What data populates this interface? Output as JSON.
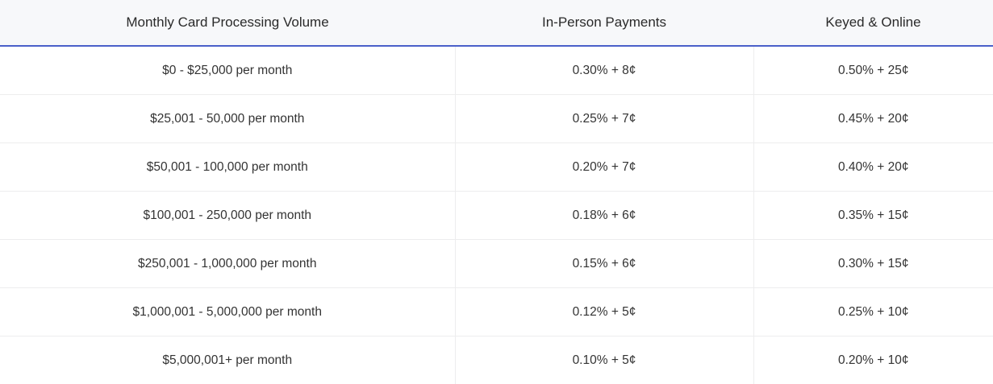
{
  "table": {
    "headers": [
      "Monthly Card Processing Volume",
      "In-Person Payments",
      "Keyed & Online"
    ],
    "rows": [
      [
        "$0 - $25,000 per month",
        "0.30% + 8¢",
        "0.50% + 25¢"
      ],
      [
        "$25,001 - 50,000 per month",
        "0.25% + 7¢",
        "0.45% + 20¢"
      ],
      [
        "$50,001 - 100,000 per month",
        "0.20% + 7¢",
        "0.40% + 20¢"
      ],
      [
        "$100,001 - 250,000 per month",
        "0.18% + 6¢",
        "0.35% + 15¢"
      ],
      [
        "$250,001 - 1,000,000 per month",
        "0.15% + 6¢",
        "0.30% + 15¢"
      ],
      [
        "$1,000,001 - 5,000,000 per month",
        "0.12% + 5¢",
        "0.25% + 10¢"
      ],
      [
        "$5,000,001+ per month",
        "0.10% + 5¢",
        "0.20% + 10¢"
      ]
    ]
  },
  "colors": {
    "header_background": "#f7f8fa",
    "header_underline": "#4a60c9",
    "row_divider": "#ededee"
  }
}
